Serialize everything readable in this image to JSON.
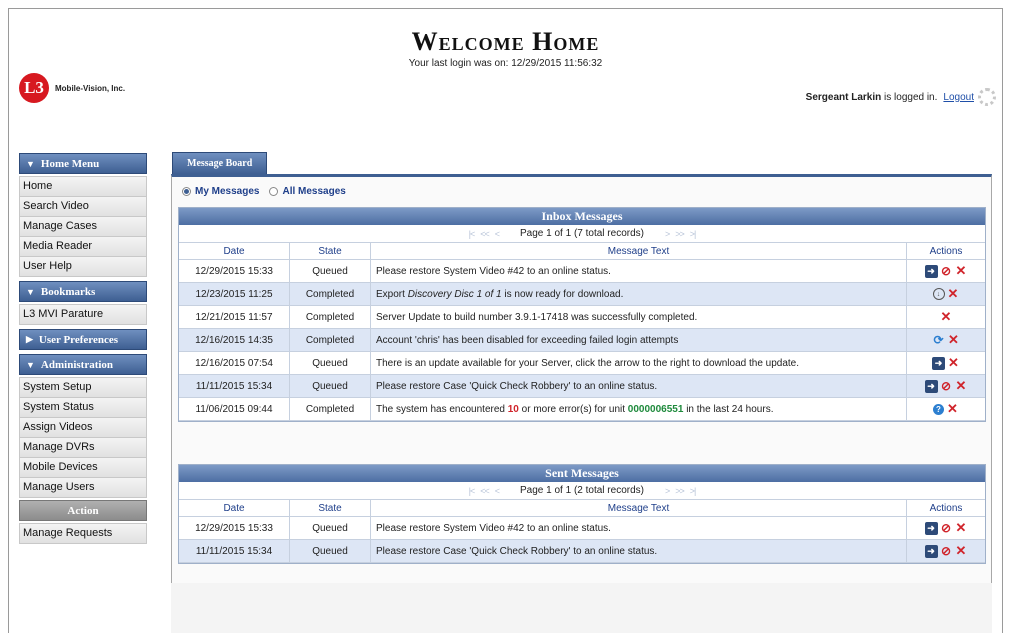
{
  "header": {
    "logo_mark": "L3",
    "logo_text": "Mobile-Vision, Inc.",
    "title": "Welcome Home",
    "last_login": "Your last login was on: 12/29/2015 11:56:32",
    "user": "Sergeant Larkin",
    "logged_in_text": "is logged in.",
    "logout": "Logout"
  },
  "sidebar": {
    "home_menu": {
      "title": "Home Menu",
      "items": [
        "Home",
        "Search Video",
        "Manage Cases",
        "Media Reader",
        "User Help"
      ]
    },
    "bookmarks": {
      "title": "Bookmarks",
      "items": [
        "L3 MVI Parature"
      ]
    },
    "user_prefs": {
      "title": "User Preferences"
    },
    "administration": {
      "title": "Administration",
      "items": [
        "System Setup",
        "System Status",
        "Assign Videos",
        "Manage DVRs",
        "Mobile Devices",
        "Manage Users"
      ]
    },
    "action": {
      "title": "Action",
      "items": [
        "Manage Requests"
      ]
    }
  },
  "tab": {
    "label": "Message Board"
  },
  "filter": {
    "my_messages": "My Messages",
    "all_messages": "All Messages",
    "selected": "my_messages"
  },
  "columns": {
    "date": "Date",
    "state": "State",
    "message": "Message Text",
    "actions": "Actions"
  },
  "inbox": {
    "title": "Inbox Messages",
    "pager": "Page 1 of 1 (7 total records)",
    "rows": [
      {
        "date": "12/29/2015 15:33",
        "state": "Queued",
        "message": "Please restore System Video #42 to an online status.",
        "actions": [
          "restore",
          "cancel",
          "delete"
        ]
      },
      {
        "date": "12/23/2015 11:25",
        "state": "Completed",
        "message_pre": "Export ",
        "message_em": "Discovery Disc 1 of 1",
        "message_post": " is now ready for download.",
        "actions": [
          "download",
          "delete"
        ]
      },
      {
        "date": "12/21/2015 11:57",
        "state": "Completed",
        "message": "Server Update to build number 3.9.1-17418 was successfully completed.",
        "actions": [
          "delete"
        ]
      },
      {
        "date": "12/16/2015 14:35",
        "state": "Completed",
        "message": "Account 'chris' has been disabled for exceeding failed login attempts",
        "actions": [
          "enable",
          "delete"
        ]
      },
      {
        "date": "12/16/2015 07:54",
        "state": "Queued",
        "message": "There is an update available for your Server, click the arrow to the right to download the update.",
        "actions": [
          "restore",
          "delete"
        ]
      },
      {
        "date": "11/11/2015 15:34",
        "state": "Queued",
        "message": "Please restore Case 'Quick Check Robbery' to an online status.",
        "actions": [
          "restore",
          "cancel",
          "delete"
        ]
      },
      {
        "date": "11/06/2015 09:44",
        "state": "Completed",
        "message_pre": "The system has encountered ",
        "message_red": "10",
        "message_mid": " or more error(s) for unit ",
        "message_green": "0000006551",
        "message_post": " in the last 24 hours.",
        "actions": [
          "help",
          "delete"
        ]
      }
    ]
  },
  "sent": {
    "title": "Sent Messages",
    "pager": "Page 1 of 1 (2 total records)",
    "rows": [
      {
        "date": "12/29/2015 15:33",
        "state": "Queued",
        "message": "Please restore System Video #42 to an online status.",
        "actions": [
          "restore",
          "cancel",
          "delete"
        ]
      },
      {
        "date": "11/11/2015 15:34",
        "state": "Queued",
        "message": "Please restore Case 'Quick Check Robbery' to an online status.",
        "actions": [
          "restore",
          "cancel",
          "delete"
        ]
      }
    ]
  },
  "colors": {
    "header_blue": "#3e5f92",
    "alt_row": "#dde6f5",
    "red": "#d0242b",
    "green": "#1e8a3c"
  },
  "icons": {
    "restore": "arrow-right-icon",
    "cancel": "cancel-circle-icon",
    "delete": "x-icon",
    "download": "download-icon",
    "enable": "enable-account-icon",
    "help": "help-icon"
  }
}
